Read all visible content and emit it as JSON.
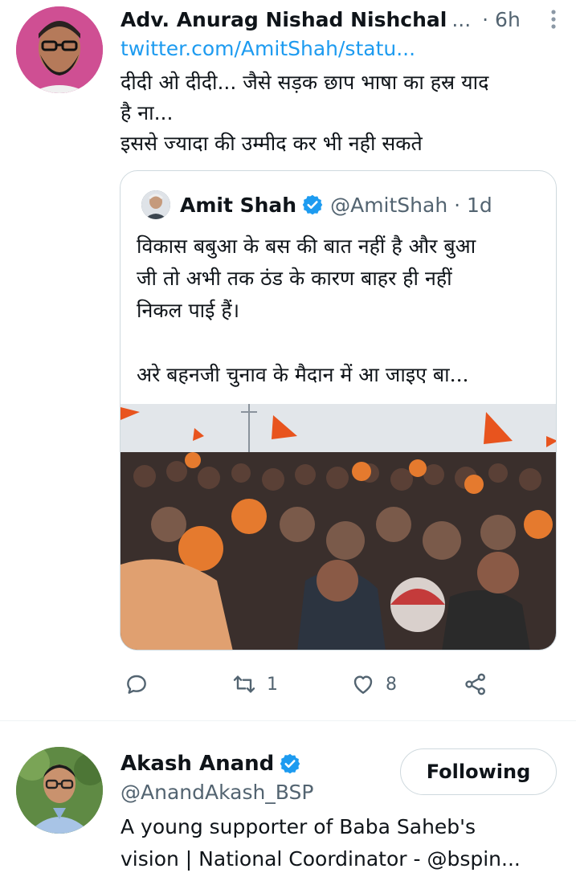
{
  "tweet": {
    "author_name": "Adv. Anurag Nishad Nishchal",
    "name_ellipsis": "...",
    "time": "· 6h",
    "link_text": "twitter.com/AmitShah/statu...",
    "text": "दीदी ओ दीदी... जैसे सड़क छाप भाषा का हस्र याद\nहै ना...\nइससे ज्यादा की उम्मीद कर भी नही सकते",
    "more_icon": "more-vertical-icon",
    "quote": {
      "author_name": "Amit Shah",
      "verified_icon": "verified-badge-icon",
      "handle_time": "@AmitShah · 1d",
      "text": "विकास बबुआ के बस की बात नहीं है और बुआ\nजी तो अभी तक ठंड के कारण बाहर ही नहीं\nनिकल पाई हैं।\n\nअरे बहनजी चुनाव के मैदान में आ जाइए बा..."
    },
    "actions": {
      "reply_icon": "reply-icon",
      "retweet_icon": "retweet-icon",
      "retweet_count": "1",
      "like_icon": "heart-icon",
      "like_count": "8",
      "share_icon": "share-icon"
    }
  },
  "user_card": {
    "name": "Akash Anand",
    "verified_icon": "verified-badge-icon",
    "handle": "@AnandAkash_BSP",
    "follow_label": "Following",
    "bio": "A young supporter of Baba Saheb's\nvision | National Coordinator - @bspin..."
  },
  "colors": {
    "link": "#1d9bf0",
    "secondary_text": "#536471",
    "border": "#cfd9de",
    "verified": "#1d9bf0"
  }
}
